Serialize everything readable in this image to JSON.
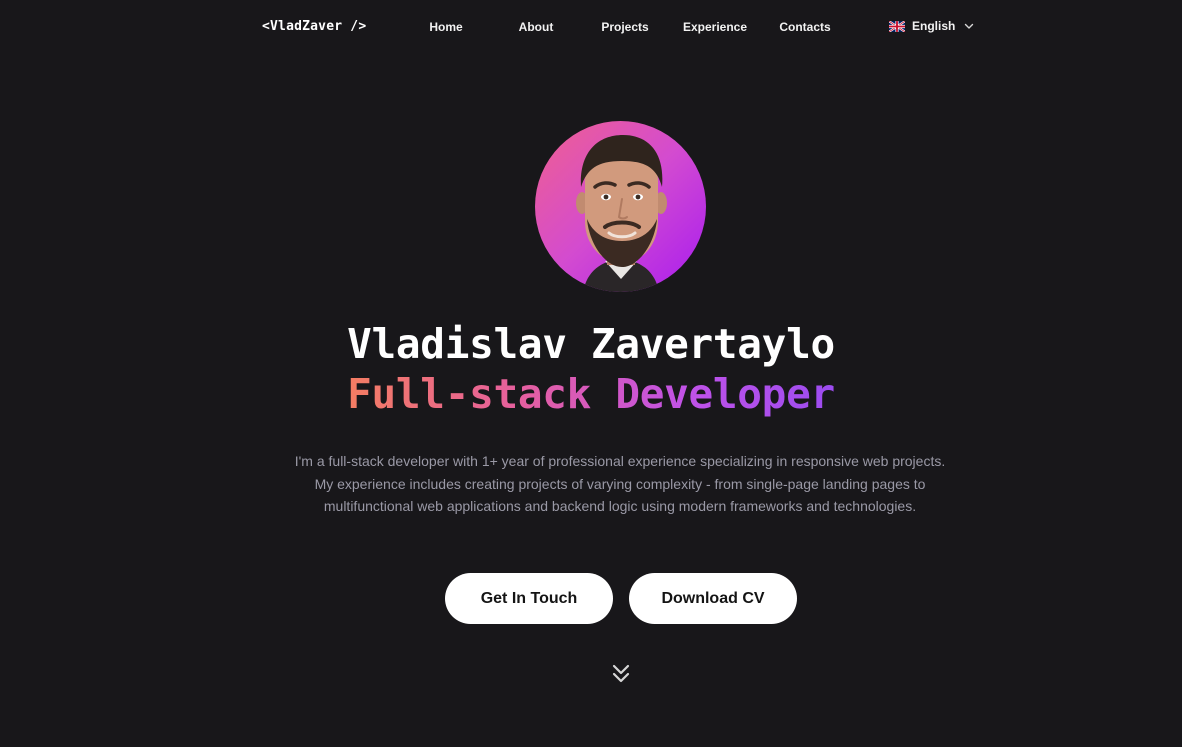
{
  "nav": {
    "logo": "<VladZaver />",
    "links": [
      "Home",
      "About",
      "Projects",
      "Experience",
      "Contacts"
    ],
    "language": {
      "label": "English",
      "flag_icon": "uk-flag-icon",
      "chevron_icon": "chevron-down-icon"
    }
  },
  "hero": {
    "avatar_icon": "profile-photo",
    "name": "Vladislav Zavertaylo",
    "role": "Full-stack Developer",
    "description": "I'm a full-stack developer with 1+ year of professional experience specializing in responsive web projects. My experience includes creating projects of varying complexity - from single-page landing pages to multifunctional web applications and backend logic using modern frameworks and technologies.",
    "buttons": {
      "get_in_touch": "Get In Touch",
      "download_cv": "Download CV"
    },
    "scroll_icon": "double-chevron-down-icon"
  },
  "colors": {
    "background": "#18171a",
    "text_primary": "#ffffff",
    "text_muted": "#9a99a6",
    "gradient_start": "#f47d62",
    "gradient_mid": "#e65f9e",
    "gradient_end": "#9c4cf0",
    "button_bg": "#ffffff"
  }
}
